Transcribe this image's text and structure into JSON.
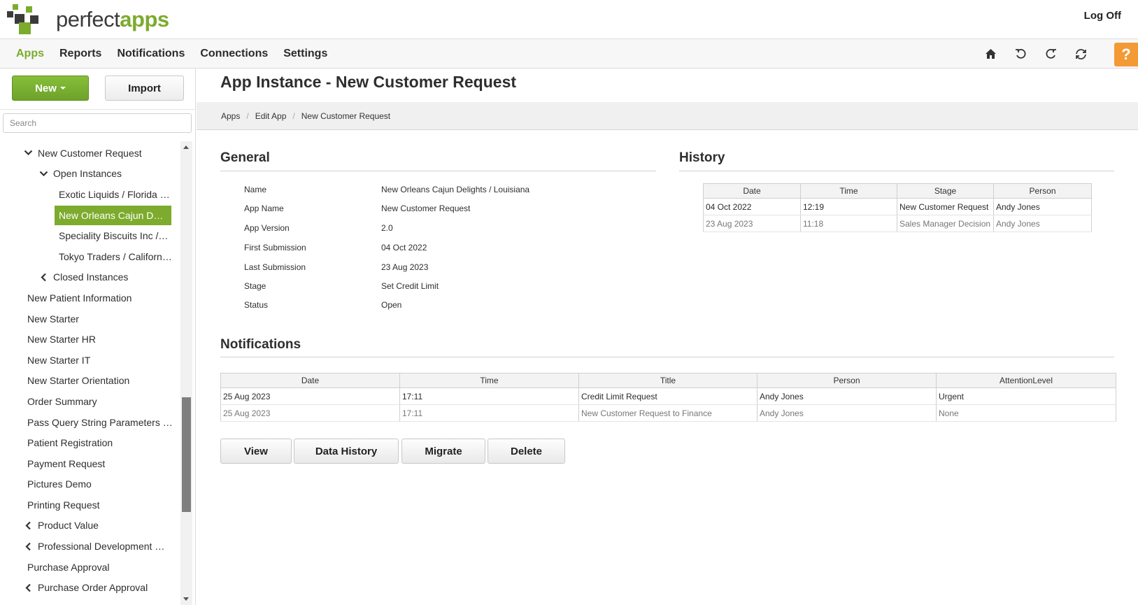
{
  "brand": {
    "part1": "perfect",
    "part2": "apps",
    "colors": {
      "dark": "#3b3b3b",
      "green": "#7cab2d"
    }
  },
  "header": {
    "logoff": "Log Off"
  },
  "nav": {
    "items": [
      "Apps",
      "Reports",
      "Notifications",
      "Connections",
      "Settings"
    ],
    "active": "Apps",
    "icons": [
      "home-icon",
      "undo-icon",
      "refresh-icon",
      "sync-icon"
    ],
    "help": "?"
  },
  "sidebar": {
    "new_label": "New",
    "import_label": "Import",
    "search_placeholder": "Search",
    "tree": [
      {
        "label": "New Customer Request",
        "chevron": "down"
      },
      {
        "label": "Open Instances",
        "chevron": "down"
      },
      {
        "label": "Exotic Liquids / Florida ( …"
      },
      {
        "label": "New Orleans Cajun Delig…",
        "selected": true
      },
      {
        "label": "Speciality Biscuits Inc / M…"
      },
      {
        "label": "Tokyo Traders / California…"
      },
      {
        "label": "Closed Instances",
        "chevron": "left"
      },
      {
        "label": "New Patient Information"
      },
      {
        "label": "New Starter"
      },
      {
        "label": "New Starter HR"
      },
      {
        "label": "New Starter IT"
      },
      {
        "label": "New Starter Orientation"
      },
      {
        "label": "Order Summary"
      },
      {
        "label": "Pass Query String Parameters Ex…"
      },
      {
        "label": "Patient Registration"
      },
      {
        "label": "Payment Request"
      },
      {
        "label": "Pictures Demo"
      },
      {
        "label": "Printing Request"
      },
      {
        "label": "Product Value",
        "chevron": "left"
      },
      {
        "label": "Professional Development Re…",
        "chevron": "left"
      },
      {
        "label": "Purchase Approval"
      },
      {
        "label": "Purchase Order Approval",
        "chevron": "left"
      }
    ]
  },
  "main": {
    "title": "App Instance - New Customer Request",
    "breadcrumb": [
      "Apps",
      "Edit App",
      "New Customer Request"
    ],
    "general": {
      "heading": "General",
      "fields": [
        {
          "label": "Name",
          "value": "New Orleans Cajun Delights / Louisiana"
        },
        {
          "label": "App Name",
          "value": "New Customer Request"
        },
        {
          "label": "App Version",
          "value": "2.0"
        },
        {
          "label": "First Submission",
          "value": "04 Oct 2022"
        },
        {
          "label": "Last Submission",
          "value": "23 Aug 2023"
        },
        {
          "label": "Stage",
          "value": "Set Credit Limit"
        },
        {
          "label": "Status",
          "value": "Open"
        }
      ]
    },
    "history": {
      "heading": "History",
      "columns": [
        "Date",
        "Time",
        "Stage",
        "Person"
      ],
      "rows": [
        [
          "04 Oct 2022",
          "12:19",
          "New Customer Request",
          "Andy Jones"
        ],
        [
          "23 Aug 2023",
          "11:18",
          "Sales Manager Decision",
          "Andy Jones"
        ]
      ]
    },
    "notifications": {
      "heading": "Notifications",
      "columns": [
        "Date",
        "Time",
        "Title",
        "Person",
        "AttentionLevel"
      ],
      "rows": [
        [
          "25 Aug 2023",
          "17:11",
          "Credit Limit Request",
          "Andy Jones",
          "Urgent"
        ],
        [
          "25 Aug 2023",
          "17:11",
          "New Customer Request to Finance",
          "Andy Jones",
          "None"
        ]
      ]
    },
    "actions": [
      "View",
      "Data History",
      "Migrate",
      "Delete"
    ]
  }
}
